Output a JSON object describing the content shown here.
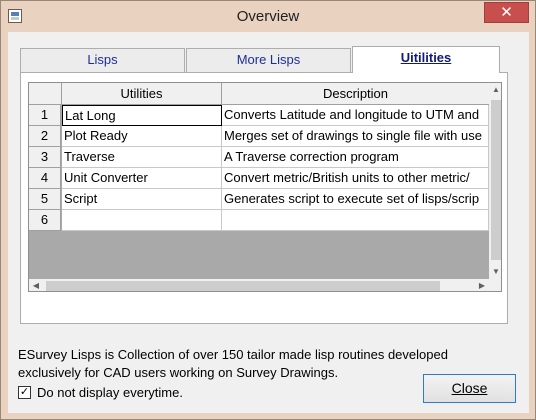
{
  "window": {
    "title": "Overview",
    "close_glyph": "✕",
    "icon": "app-grid-icon"
  },
  "tabs": [
    {
      "label": "Lisps",
      "active": false
    },
    {
      "label": "More Lisps",
      "active": false
    },
    {
      "label": "Uitilities",
      "active": true
    }
  ],
  "grid": {
    "columns": [
      "Utilities",
      "Description"
    ],
    "rows": [
      {
        "num": "1",
        "name": "Lat Long",
        "description": "Converts Latitude and longitude to UTM and"
      },
      {
        "num": "2",
        "name": "Plot Ready",
        "description": "Merges set of drawings to single file with use"
      },
      {
        "num": "3",
        "name": "Traverse",
        "description": "A Traverse correction program"
      },
      {
        "num": "4",
        "name": "Unit Converter",
        "description": "Convert metric/British units to other metric/"
      },
      {
        "num": "5",
        "name": "Script",
        "description": "Generates script to execute set of lisps/scrip"
      },
      {
        "num": "6",
        "name": "",
        "description": ""
      }
    ],
    "selected_row": 1
  },
  "footer": {
    "description": "ESurvey Lisps is Collection of over 150 tailor made lisp routines developed exclusively for CAD users working on Survey Drawings.",
    "checkbox_label": "Do not display everytime.",
    "checkbox_checked": true,
    "checkbox_glyph": "✓",
    "close_label": "Close"
  },
  "colors": {
    "tab_text": "#1d2e9a",
    "title_close_bg": "#c7504f",
    "grid_empty_bg": "#a9a9a9",
    "close_button_border": "#2f7ac9"
  }
}
